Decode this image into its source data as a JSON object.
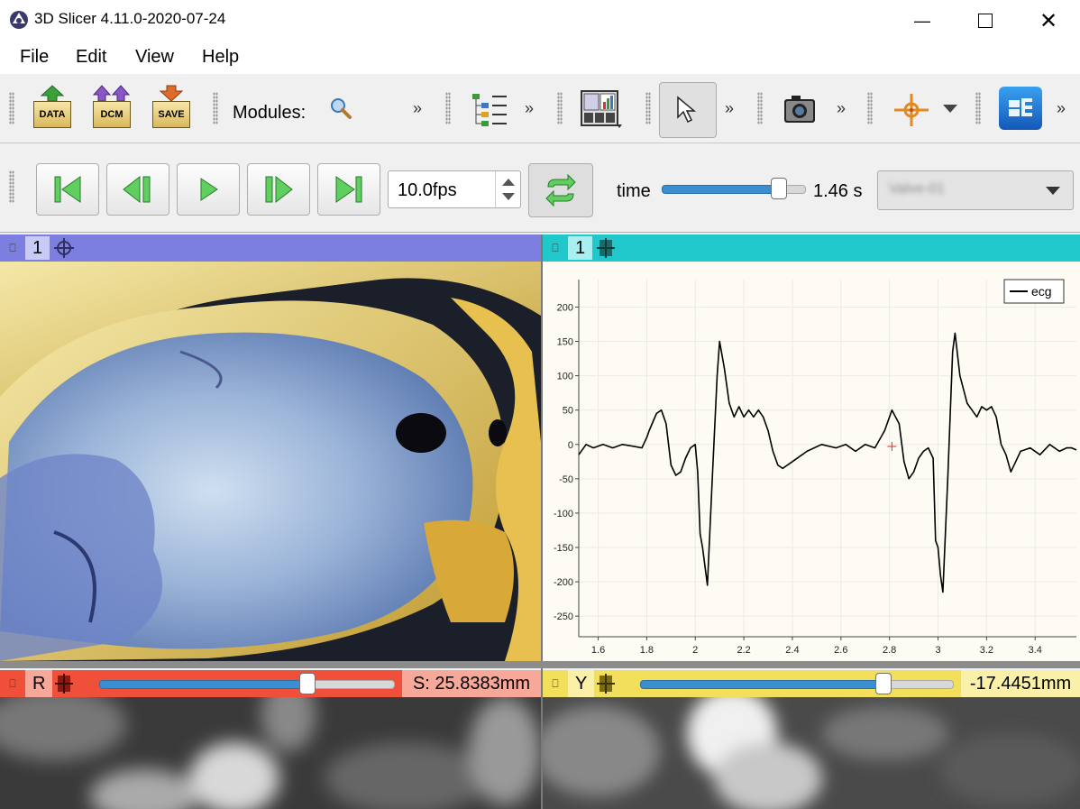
{
  "window": {
    "title": "3D Slicer 4.11.0-2020-07-24",
    "minimize_icon": "minimize-icon",
    "maximize_icon": "maximize-icon",
    "close_icon": "close-icon"
  },
  "menu": [
    "File",
    "Edit",
    "View",
    "Help"
  ],
  "toolbar": {
    "data_label": "DATA",
    "dcm_label": "DCM",
    "save_label": "SAVE",
    "modules_label": "Modules:",
    "more": "»"
  },
  "sequence_bar": {
    "fps": "10.0fps",
    "time_label": "time",
    "time_value": "1.46 s",
    "time_fraction": 0.82,
    "browser_value": "Valve-01"
  },
  "views": {
    "three_d": {
      "label": "1",
      "color": "#7c7fe0"
    },
    "plot": {
      "label": "1",
      "color": "#20c8cc"
    },
    "red": {
      "label": "R",
      "offset_text": "S: 25.8383mm",
      "slider_fraction": 0.71,
      "color": "#f0503a"
    },
    "yellow": {
      "label": "Y",
      "offset_text": "-17.4451mm",
      "slider_fraction": 0.78,
      "color": "#f2df5c"
    }
  },
  "chart_data": {
    "type": "line",
    "series": [
      {
        "name": "ecg"
      }
    ],
    "x": [
      1.52,
      1.55,
      1.58,
      1.62,
      1.66,
      1.7,
      1.75,
      1.78,
      1.8,
      1.81,
      1.84,
      1.86,
      1.88,
      1.9,
      1.92,
      1.94,
      1.96,
      1.98,
      2.0,
      2.01,
      2.02,
      2.03,
      2.05,
      2.07,
      2.09,
      2.1,
      2.12,
      2.14,
      2.16,
      2.18,
      2.2,
      2.22,
      2.24,
      2.26,
      2.28,
      2.3,
      2.32,
      2.34,
      2.36,
      2.4,
      2.46,
      2.52,
      2.58,
      2.62,
      2.66,
      2.7,
      2.74,
      2.78,
      2.81,
      2.84,
      2.86,
      2.88,
      2.9,
      2.92,
      2.94,
      2.96,
      2.98,
      2.99,
      3.0,
      3.01,
      3.02,
      3.04,
      3.06,
      3.07,
      3.09,
      3.12,
      3.14,
      3.16,
      3.18,
      3.2,
      3.22,
      3.24,
      3.26,
      3.28,
      3.3,
      3.32,
      3.34,
      3.38,
      3.42,
      3.46,
      3.5,
      3.53,
      3.55,
      3.57
    ],
    "y": [
      -15,
      0,
      -5,
      0,
      -5,
      0,
      -3,
      -5,
      10,
      20,
      45,
      50,
      30,
      -30,
      -45,
      -40,
      -20,
      -5,
      0,
      -40,
      -130,
      -150,
      -205,
      -50,
      100,
      150,
      110,
      60,
      40,
      55,
      40,
      50,
      40,
      50,
      40,
      20,
      -10,
      -30,
      -35,
      -25,
      -10,
      0,
      -5,
      0,
      -10,
      0,
      -5,
      20,
      50,
      30,
      -25,
      -50,
      -40,
      -20,
      -10,
      -5,
      -20,
      -140,
      -150,
      -190,
      -215,
      -50,
      135,
      162,
      100,
      60,
      50,
      40,
      55,
      50,
      55,
      40,
      0,
      -15,
      -40,
      -25,
      -10,
      -5,
      -15,
      0,
      -10,
      -5,
      -5,
      -8
    ],
    "xlim": [
      1.52,
      3.57
    ],
    "ylim": [
      -280,
      240
    ],
    "xticks": [
      "1.6",
      "1.8",
      "2",
      "2.2",
      "2.4",
      "2.6",
      "2.8",
      "3",
      "3.2",
      "3.4"
    ],
    "yticks": [
      "200",
      "150",
      "100",
      "50",
      "0",
      "-50",
      "-100",
      "-150",
      "-200",
      "-250"
    ],
    "grid": true,
    "legend_position": "top-right",
    "cursor_x": 2.81,
    "cursor_y": -3
  }
}
